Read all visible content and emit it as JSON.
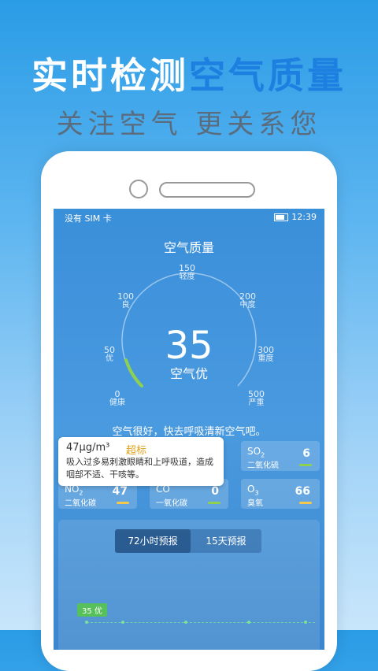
{
  "headline": {
    "part1": "实时检测",
    "part2": "空气质量"
  },
  "subline": "关注空气  更关系您",
  "status_bar": {
    "left_text": "没有 SIM 卡",
    "time": "12:39"
  },
  "screen_title": "空气质量",
  "gauge": {
    "ticks": [
      {
        "num": "0",
        "label": "健康"
      },
      {
        "num": "50",
        "label": "优"
      },
      {
        "num": "100",
        "label": "良"
      },
      {
        "num": "150",
        "label": "轻度"
      },
      {
        "num": "200",
        "label": "中度"
      },
      {
        "num": "300",
        "label": "重度"
      },
      {
        "num": "500",
        "label": "严重"
      }
    ],
    "value": "35",
    "level": "空气优",
    "progress_color": "#8fd14f"
  },
  "tip_line": "空气很好，快去呼吸清新空气吧。",
  "popup": {
    "value": "47μg/m³",
    "badge": "超标",
    "desc": "吸入过多易刺激眼睛和上呼吸道，造成咽部不适、干咳等。"
  },
  "pollutants": [
    {
      "symbol": "SO",
      "sub": "2",
      "name": "二氧化硫",
      "value": "6",
      "bar_color": "#8fd14f"
    },
    {
      "symbol": "NO",
      "sub": "2",
      "name": "二氧化碳",
      "value": "47",
      "bar_color": "#f2c94c"
    },
    {
      "symbol": "CO",
      "sub": "",
      "name": "一氧化碳",
      "value": "0",
      "bar_color": "#8fd14f"
    },
    {
      "symbol": "O",
      "sub": "3",
      "name": "臭氧",
      "value": "66",
      "bar_color": "#f2c94c"
    }
  ],
  "forecast": {
    "tabs": [
      "72小时预报",
      "15天预报"
    ],
    "active_tab": 0,
    "current_badge": "35 优"
  },
  "colors": {
    "accent": "#1d7fe0",
    "screen_bg": "#3f90dc",
    "good": "#56c05a"
  }
}
